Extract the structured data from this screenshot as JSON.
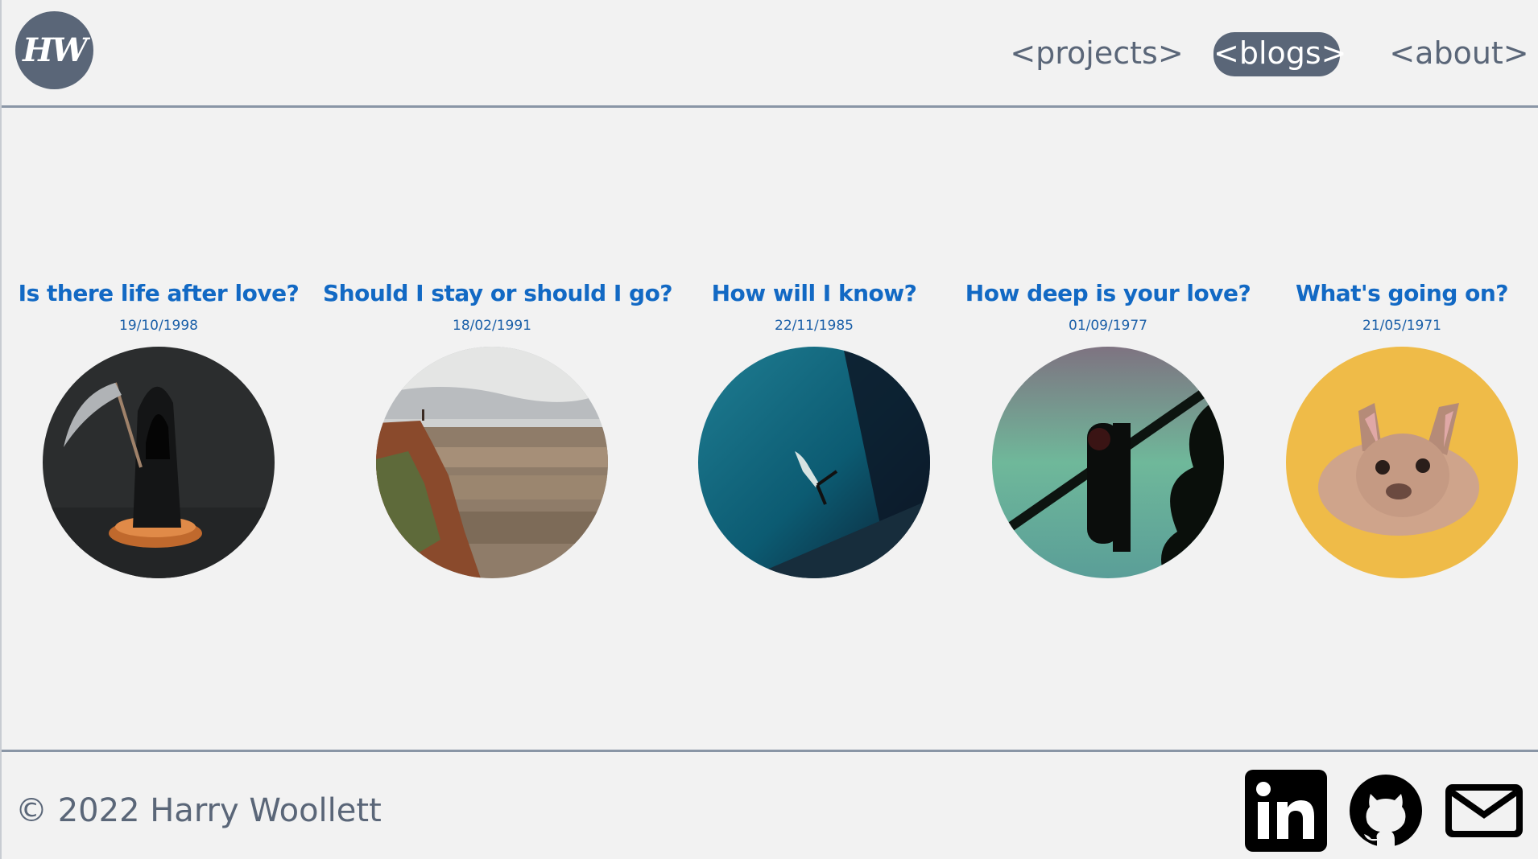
{
  "header": {
    "logo_text": "HW",
    "nav": [
      {
        "label": "<projects>"
      },
      {
        "label": "<blogs>",
        "active": true
      },
      {
        "label": "<about>"
      }
    ]
  },
  "blogs": [
    {
      "title": "Is there life after love?",
      "date": "19/10/1998",
      "image": "grim-reaper"
    },
    {
      "title": "Should I stay or should I go?",
      "date": "18/02/1991",
      "image": "canyon-cliff"
    },
    {
      "title": "How will I know?",
      "date": "22/11/1985",
      "image": "underwater-diver"
    },
    {
      "title": "How deep is your love?",
      "date": "01/09/1977",
      "image": "traffic-light"
    },
    {
      "title": "What's going on?",
      "date": "21/05/1971",
      "image": "french-bulldog"
    }
  ],
  "footer": {
    "copyright": "© 2022 Harry Woollett",
    "social": [
      {
        "icon": "linkedin-icon"
      },
      {
        "icon": "github-icon"
      },
      {
        "icon": "mail-icon"
      }
    ]
  },
  "colors": {
    "background": "#f2f2f2",
    "slate": "#5a6678",
    "accent_blue": "#1269c4",
    "divider": "#8a96a6"
  }
}
